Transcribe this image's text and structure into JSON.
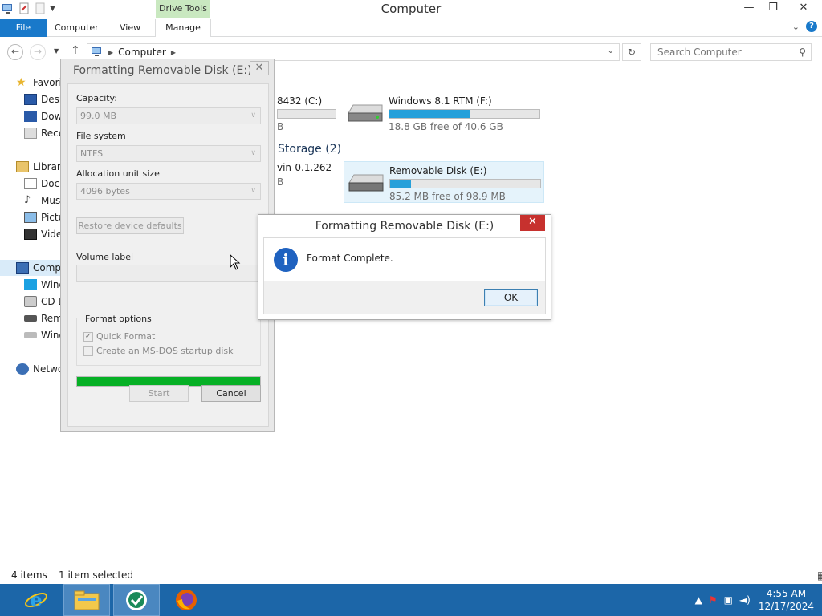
{
  "window": {
    "title": "Computer",
    "contextual_tab": "Drive Tools",
    "controls": {
      "minimize": "—",
      "restore": "❐",
      "close": "✕"
    }
  },
  "ribbon": {
    "tabs": [
      "File",
      "Computer",
      "View",
      "Manage"
    ]
  },
  "address": {
    "path": "Computer",
    "search_placeholder": "Search Computer"
  },
  "nav": {
    "items": [
      {
        "label": "Favori",
        "icon": "star-icon"
      },
      {
        "label": "Desk",
        "icon": "desktop-icon"
      },
      {
        "label": "Dow",
        "icon": "downloads-icon"
      },
      {
        "label": "Rece",
        "icon": "recent-icon"
      },
      {
        "label": "Librari",
        "icon": "libraries-icon"
      },
      {
        "label": "Docu",
        "icon": "documents-icon"
      },
      {
        "label": "Mus",
        "icon": "music-icon"
      },
      {
        "label": "Pictu",
        "icon": "pictures-icon"
      },
      {
        "label": "Vide",
        "icon": "videos-icon"
      },
      {
        "label": "Comp",
        "icon": "computer-icon"
      },
      {
        "label": "Wind",
        "icon": "windows-drive-icon"
      },
      {
        "label": "CD D",
        "icon": "cd-drive-icon"
      },
      {
        "label": "Rem",
        "icon": "removable-drive-icon"
      },
      {
        "label": "Wind",
        "icon": "drive-icon"
      },
      {
        "label": "Netwo",
        "icon": "network-icon"
      }
    ]
  },
  "content": {
    "hard_drives": [
      {
        "name": "8432 (C:)",
        "free": "B",
        "used_fraction": 0.3
      },
      {
        "name": "Windows 8.1 RTM (F:)",
        "free": "18.8 GB free of 40.6 GB",
        "used_fraction": 0.54
      }
    ],
    "removable_header": "Storage (2)",
    "removable": [
      {
        "name": "vin-0.1.262",
        "free": "B"
      },
      {
        "name": "Removable Disk (E:)",
        "free": "85.2 MB free of 98.9 MB",
        "used_fraction": 0.14
      }
    ]
  },
  "status": {
    "items": "4 items",
    "selected": "1 item selected"
  },
  "format_dialog": {
    "title": "Formatting Removable Disk (E:)",
    "capacity_label": "Capacity:",
    "capacity_value": "99.0 MB",
    "fs_label": "File system",
    "fs_value": "NTFS",
    "alloc_label": "Allocation unit size",
    "alloc_value": "4096 bytes",
    "restore_button": "Restore device defaults",
    "volume_label": "Volume label",
    "format_options": "Format options",
    "quick_format": "Quick Format",
    "msdos_disk": "Create an MS-DOS startup disk",
    "progress": 1.0,
    "start_button": "Start",
    "cancel_button": "Cancel"
  },
  "message_box": {
    "title": "Formatting Removable Disk (E:)",
    "text": "Format Complete.",
    "ok_button": "OK"
  },
  "taskbar": {
    "time": "4:55 AM",
    "date": "12/17/2024",
    "apps": [
      "internet-explorer-icon",
      "file-explorer-icon",
      "app-icon",
      "firefox-icon"
    ]
  }
}
